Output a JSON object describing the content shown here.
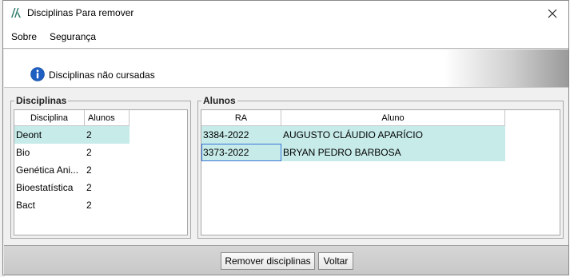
{
  "window": {
    "title": "Disciplinas Para remover",
    "close_glyph": "✕"
  },
  "menu": {
    "items": [
      "Sobre",
      "Segurança"
    ]
  },
  "info": {
    "text": "Disciplinas não cursadas",
    "icon": "info-icon"
  },
  "disciplinas": {
    "title": "Disciplinas",
    "columns": [
      "Disciplina",
      "Alunos"
    ],
    "rows": [
      {
        "disciplina": "Deont",
        "alunos": "2"
      },
      {
        "disciplina": "Bio",
        "alunos": "2"
      },
      {
        "disciplina": "Genética Ani...",
        "alunos": "2"
      },
      {
        "disciplina": "Bioestatística",
        "alunos": "2"
      },
      {
        "disciplina": "Bact",
        "alunos": "2"
      }
    ],
    "selected_index": 0
  },
  "alunos": {
    "title": "Alunos",
    "columns": [
      "RA",
      "Aluno"
    ],
    "rows": [
      {
        "ra": "3384-2022",
        "aluno": "AUGUSTO CLÁUDIO APARÍCIO"
      },
      {
        "ra": "3373-2022",
        "aluno": "BRYAN PEDRO BARBOSA"
      }
    ]
  },
  "buttons": {
    "remover": "Remover disciplinas",
    "voltar": "Voltar"
  },
  "colors": {
    "selection": "#c6ebe9",
    "info_blue": "#1f5fc2"
  }
}
